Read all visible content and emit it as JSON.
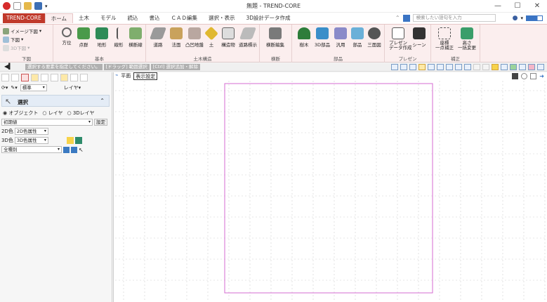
{
  "title": "無題 - TREND-CORE",
  "window_controls": {
    "minimize": "—",
    "maximize": "☐",
    "close": "✕"
  },
  "tabs": [
    "TREND-CORE",
    "ホーム",
    "土木",
    "モデル",
    "読込",
    "書込",
    "ＣＡＤ編集",
    "選択・表示",
    "3D設計データ作成"
  ],
  "search_placeholder": "検索したい語句を入力",
  "ribbon": {
    "view_group": {
      "label": "下図",
      "items": [
        "イメージ下図",
        "下図",
        "3D下図"
      ]
    },
    "basic_group": {
      "label": "基本",
      "buttons": [
        "方位",
        "点群",
        "地形",
        "線形",
        "横断線"
      ]
    },
    "civil_group": {
      "label": "土木構造",
      "buttons": [
        "道路",
        "法面",
        "凸凹地盤",
        "土",
        "構造物",
        "道路標示"
      ]
    },
    "cross_group": {
      "label": "横断",
      "buttons": [
        "横断編集"
      ]
    },
    "parts_group": {
      "label": "部品",
      "buttons": [
        "樹木",
        "3D部品",
        "汎用",
        "部品",
        "三面図"
      ]
    },
    "present_group": {
      "label": "プレゼン",
      "buttons": [
        "プレゼン\nデータ作成",
        "シーン"
      ]
    },
    "correct_group": {
      "label": "補正",
      "buttons": [
        "座標\n一点補正",
        "高さ\n一括変更"
      ]
    }
  },
  "hint": [
    "選択する要素を指定してください。",
    "[ドラッグ] 範囲選択",
    "[Ctrl] 選択追加・解除"
  ],
  "panel": {
    "std_label": "標準",
    "layer_label": "レイヤ",
    "select_title": "選択",
    "radios": [
      "オブジェクト",
      "レイヤ",
      "3Dレイヤ"
    ],
    "initial": "初期値",
    "settings": "設定",
    "row2d_label": "2D色",
    "row2d_value": "2D色属性",
    "row3d_label": "3D色",
    "row3d_value": "3D色属性",
    "type_value": "全種別"
  },
  "canvas_tabs": [
    "平面",
    "表示設定"
  ],
  "colors": {
    "accent": "#c0392b",
    "ribbon_bg": "#fbeeee",
    "grid_rect": "#d46bd0"
  }
}
